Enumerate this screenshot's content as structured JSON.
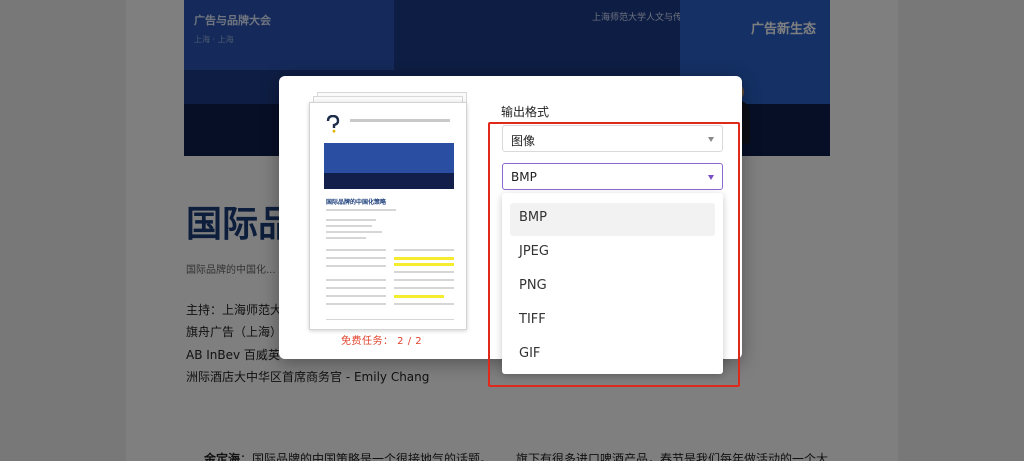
{
  "article": {
    "hero_left_line1": "上海 · 上海",
    "hero_left_line2": "广告与品牌大会",
    "hero_panel_line": "上海师范大学人文与传播学院教授",
    "hero_right_label": "广告新生态",
    "title": "国际品",
    "subtitle": "国际品牌的中国化...",
    "host_line": "主持：上海师范大",
    "line2": "旗舟广告（上海）",
    "line3": "AB InBev 百威英",
    "line4": "洲际酒店大中华区首席商务官 - Emily Chang",
    "body_speaker": "金定海",
    "body_text": "：国际品牌的中国策略是一个很接地气的话题。",
    "body_text_right": "旗下有很多进口啤酒产品，春节是我们每年做活动的一个大"
  },
  "dialog": {
    "preview": {
      "title": "国际品牌的中国化策略",
      "task_count": "免费任务： 2 / 2"
    },
    "format_label": "输出格式",
    "output_type_select": {
      "value": "图像"
    },
    "image_format_select": {
      "value": "BMP"
    },
    "format_options": [
      "BMP",
      "JPEG",
      "PNG",
      "TIFF",
      "GIF"
    ],
    "selected_option": "BMP"
  },
  "colors": {
    "accent_purple": "#8e68cf",
    "highlight_red": "#e1291b",
    "task_count_red": "#e0412b",
    "title_blue": "#1a3c79"
  }
}
